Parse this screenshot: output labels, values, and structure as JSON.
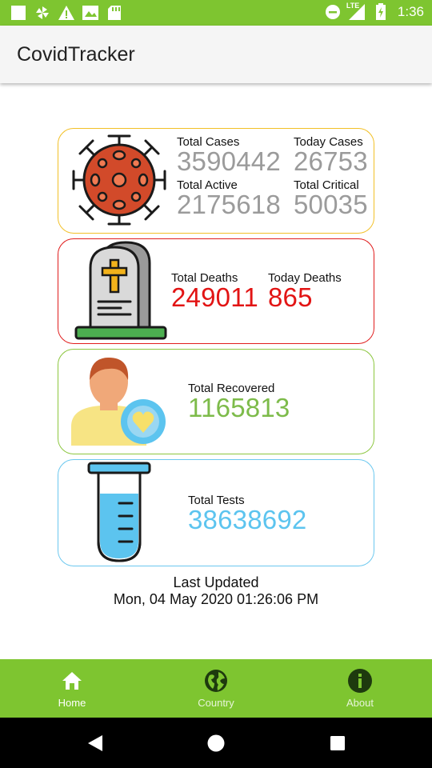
{
  "status_bar": {
    "time": "1:36",
    "network_label": "LTE",
    "icons_left": [
      "square-icon",
      "pinwheel-icon",
      "warning-icon",
      "image-icon",
      "sd-card-icon"
    ],
    "icons_right": [
      "dnd-icon",
      "signal-icon",
      "battery-icon"
    ]
  },
  "app_bar": {
    "title": "CovidTracker"
  },
  "cases_card": {
    "total_cases_label": "Total Cases",
    "total_cases": "3590442",
    "today_cases_label": "Today Cases",
    "today_cases": "26753",
    "total_active_label": "Total Active",
    "total_active": "2175618",
    "total_critical_label": "Total Critical",
    "total_critical": "50035",
    "icon": "virus-icon",
    "border_color": "#f2c027"
  },
  "deaths_card": {
    "total_deaths_label": "Total Deaths",
    "total_deaths": "249011",
    "today_deaths_label": "Today Deaths",
    "today_deaths": "865",
    "icon": "tombstone-icon",
    "border_color": "#e01d1d"
  },
  "recovered_card": {
    "label": "Total Recovered",
    "value": "1165813",
    "icon": "recovered-person-icon",
    "border_color": "#8cc63f"
  },
  "tests_card": {
    "label": "Total Tests",
    "value": "38638692",
    "icon": "test-tube-icon",
    "border_color": "#6cc8ef"
  },
  "last_updated": {
    "label": "Last Updated",
    "value": "Mon, 04 May 2020 01:26:06 PM"
  },
  "bottom_nav": {
    "items": [
      {
        "label": "Home",
        "icon": "home-icon",
        "active": true
      },
      {
        "label": "Country",
        "icon": "globe-icon",
        "active": false
      },
      {
        "label": "About",
        "icon": "info-icon",
        "active": false
      }
    ],
    "color": "#7ec530"
  },
  "system_nav": {
    "buttons": [
      "back-icon",
      "home-circle-icon",
      "recents-icon"
    ]
  }
}
